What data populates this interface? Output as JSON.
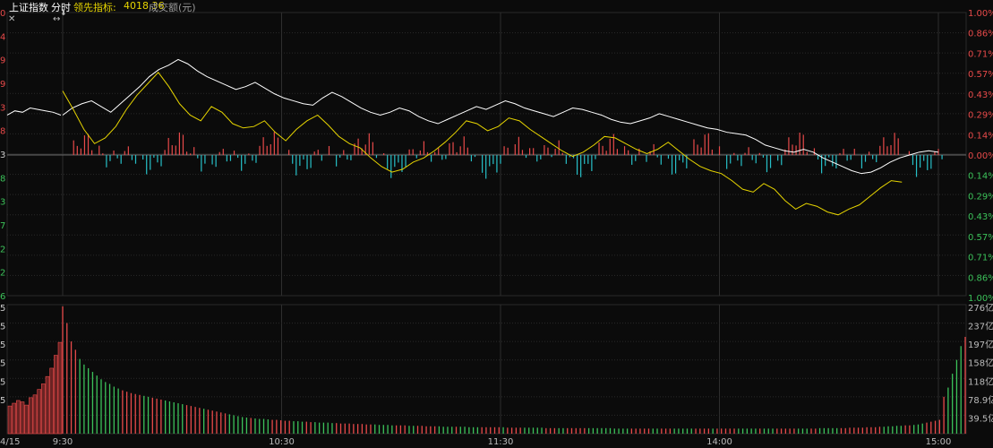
{
  "header": {
    "index_name": "上证指数",
    "mode": "分时",
    "leading_label": "领先指标:",
    "leading_value": "4018.36",
    "volume_label": "成交额(元)"
  },
  "colors": {
    "up": "#e84a4a",
    "down": "#27c0c8",
    "price_line": "#ffffff",
    "leading_line": "#e6d400",
    "grid": "#2a2a2a",
    "background": "#0b0b0b"
  },
  "chart_data": [
    {
      "type": "line",
      "title": "上证指数 分时",
      "x_ticks": [
        "9:30",
        "10:30",
        "11:30",
        "14:00",
        "15:00"
      ],
      "date_label": "4/15",
      "right_axis_up": [
        "1.00%",
        "0.86%",
        "0.71%",
        "0.57%",
        "0.43%",
        "0.29%",
        "0.14%",
        "0.00%"
      ],
      "right_axis_down": [
        "0.14%",
        "0.29%",
        "0.43%",
        "0.57%",
        "0.71%",
        "0.86%",
        "1.00%"
      ],
      "left_axis": [
        "0",
        "4",
        "9",
        "9",
        "3",
        "8",
        "3",
        "8",
        "3",
        "7",
        "2",
        "2",
        "6"
      ],
      "ylim_percent": [
        -1.0,
        1.0
      ],
      "series": [
        {
          "name": "上证指数",
          "color": "#ffffff",
          "values": [
            0.28,
            0.33,
            0.36,
            0.38,
            0.34,
            0.3,
            0.36,
            0.42,
            0.48,
            0.55,
            0.6,
            0.63,
            0.67,
            0.64,
            0.59,
            0.55,
            0.52,
            0.49,
            0.46,
            0.48,
            0.51,
            0.47,
            0.43,
            0.4,
            0.38,
            0.36,
            0.35,
            0.4,
            0.44,
            0.41,
            0.37,
            0.33,
            0.3,
            0.28,
            0.3,
            0.33,
            0.31,
            0.27,
            0.24,
            0.22,
            0.25,
            0.28,
            0.31,
            0.34,
            0.32,
            0.35,
            0.38,
            0.36,
            0.33,
            0.31,
            0.29,
            0.27,
            0.3,
            0.33,
            0.32,
            0.3,
            0.28,
            0.25,
            0.23,
            0.22,
            0.24,
            0.26,
            0.29,
            0.27,
            0.25,
            0.23,
            0.21,
            0.19,
            0.18,
            0.16,
            0.15,
            0.14,
            0.11,
            0.07,
            0.05,
            0.03,
            0.02,
            0.04,
            0.02,
            -0.02,
            -0.05,
            -0.08,
            -0.11,
            -0.13,
            -0.12,
            -0.09,
            -0.05,
            -0.02,
            0.0,
            0.02,
            0.03,
            0.02
          ],
          "x_range_minutes": [
            0,
            240
          ]
        },
        {
          "name": "领先指标",
          "color": "#e6d400",
          "values": [
            0.45,
            0.32,
            0.18,
            0.08,
            0.12,
            0.2,
            0.32,
            0.42,
            0.5,
            0.58,
            0.48,
            0.36,
            0.28,
            0.24,
            0.34,
            0.3,
            0.22,
            0.19,
            0.2,
            0.24,
            0.16,
            0.1,
            0.18,
            0.24,
            0.28,
            0.21,
            0.13,
            0.08,
            0.05,
            -0.02,
            -0.08,
            -0.12,
            -0.1,
            -0.05,
            -0.02,
            0.03,
            0.09,
            0.16,
            0.24,
            0.22,
            0.17,
            0.2,
            0.26,
            0.24,
            0.18,
            0.13,
            0.08,
            0.03,
            -0.01,
            0.02,
            0.07,
            0.13,
            0.12,
            0.08,
            0.04,
            0.01,
            0.04,
            0.09,
            0.03,
            -0.03,
            -0.08,
            -0.11,
            -0.13,
            -0.18,
            -0.24,
            -0.26,
            -0.2,
            -0.24,
            -0.32,
            -0.38,
            -0.34,
            -0.36,
            -0.4,
            -0.42,
            -0.38,
            -0.35,
            -0.29,
            -0.23,
            -0.18,
            -0.19
          ],
          "x_range_minutes": [
            0,
            230
          ]
        }
      ],
      "pre_open_segment": [
        0.28,
        0.31,
        0.3,
        0.33,
        0.32,
        0.31,
        0.3,
        0.28
      ],
      "grid": true
    },
    {
      "type": "bar",
      "title": "成交额(元)",
      "y_ticks": [
        "276亿",
        "237亿",
        "197亿",
        "158亿",
        "118亿",
        "78.9亿",
        "39.5亿"
      ],
      "left_axis": [
        "5",
        "5",
        "5",
        "5",
        "5",
        "5"
      ],
      "ylim_yi": [
        0,
        276
      ],
      "open_auction_values_yi": [
        60,
        66,
        72,
        69,
        62,
        78,
        84,
        96,
        108,
        124,
        142,
        170,
        198
      ],
      "values_yi": [
        276,
        240,
        200,
        182,
        162,
        150,
        142,
        134,
        126,
        118,
        112,
        108,
        102,
        98,
        94,
        91,
        88,
        86,
        84,
        82,
        80,
        78,
        76,
        74,
        72,
        70,
        68,
        66,
        64,
        62,
        60,
        58,
        56,
        54,
        52,
        50,
        48,
        46,
        44,
        42,
        40,
        38,
        36,
        35,
        34,
        33,
        32,
        32,
        31,
        30,
        30,
        29,
        28,
        28,
        27,
        27,
        26,
        26,
        25,
        25,
        24,
        24,
        24,
        23,
        23,
        22,
        22,
        22,
        21,
        21,
        21,
        20,
        20,
        20,
        19,
        19,
        19,
        18,
        18,
        18,
        18,
        17,
        17,
        17,
        17,
        16,
        16,
        16,
        16,
        15,
        15,
        15,
        15,
        15,
        15,
        14,
        14,
        14,
        14,
        14,
        14,
        14,
        14,
        14,
        13,
        13,
        13,
        13,
        13,
        13,
        13,
        13,
        13,
        12,
        12,
        12,
        12,
        12,
        12,
        12,
        12,
        12,
        12,
        12,
        12,
        12,
        12,
        12,
        12,
        11,
        11,
        11,
        11,
        11,
        11,
        11,
        11,
        11,
        11,
        11,
        11,
        11,
        11,
        11,
        11,
        11,
        11,
        11,
        11,
        11,
        11,
        11,
        11,
        11,
        11,
        11,
        11,
        11,
        11,
        11,
        11,
        11,
        11,
        11,
        11,
        11,
        11,
        11,
        11,
        11,
        11,
        11,
        11,
        11,
        11,
        11,
        11,
        12,
        12,
        12,
        12,
        12,
        12,
        12,
        13,
        13,
        13,
        13,
        14,
        14,
        14,
        15,
        15,
        16,
        16,
        17,
        17,
        18,
        18,
        19,
        20,
        22,
        24,
        26,
        28,
        30,
        80,
        100,
        130,
        160,
        190,
        210
      ],
      "grid": true
    }
  ]
}
